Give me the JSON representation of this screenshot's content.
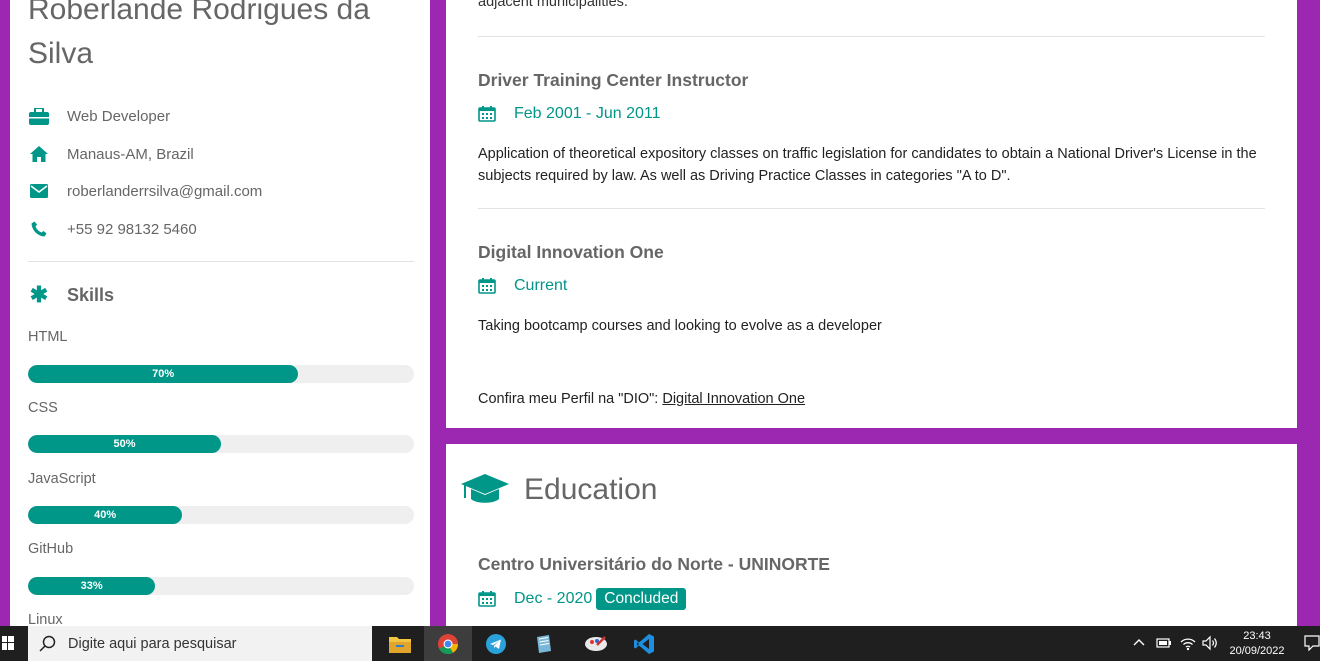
{
  "profile": {
    "name": "Roberlande Rodrigues da Silva",
    "job": "Web Developer",
    "location": "Manaus-AM, Brazil",
    "email": "roberlanderrsilva@gmail.com",
    "phone": "+55 92 98132 5460"
  },
  "skills": {
    "heading": "Skills",
    "items": [
      {
        "label": "HTML",
        "percent": 70,
        "percent_text": "70%"
      },
      {
        "label": "CSS",
        "percent": 50,
        "percent_text": "50%"
      },
      {
        "label": "JavaScript",
        "percent": 40,
        "percent_text": "40%"
      },
      {
        "label": "GitHub",
        "percent": 33,
        "percent_text": "33%"
      },
      {
        "label": "Linux"
      }
    ]
  },
  "experience": {
    "cut_text": "adjacent municipalities.",
    "jobs": [
      {
        "title": "Driver Training Center Instructor",
        "date": "Feb 2001 - Jun 2011",
        "description": "Application of theoretical expository classes on traffic legislation for candidates to obtain a National Driver's License in the subjects required by law. As well as Driving Practice Classes in categories \"A to D\"."
      },
      {
        "title": "Digital Innovation One",
        "date": "Current",
        "description": "Taking bootcamp courses and looking to evolve as a developer"
      }
    ],
    "dio_prefix": "Confira meu Perfil na \"DIO\": ",
    "dio_link": "Digital Innovation One"
  },
  "education": {
    "heading": "Education",
    "items": [
      {
        "school": "Centro Universitário do Norte - UNINORTE",
        "date": "Dec - 2020",
        "badge": "Concluded"
      }
    ]
  },
  "taskbar": {
    "search_placeholder": "Digite aqui para pesquisar",
    "time": "23:43",
    "date": "20/09/2022"
  },
  "colors": {
    "accent": "#009688",
    "background": "#9c27b0",
    "taskbar": "#1f1f1f"
  }
}
